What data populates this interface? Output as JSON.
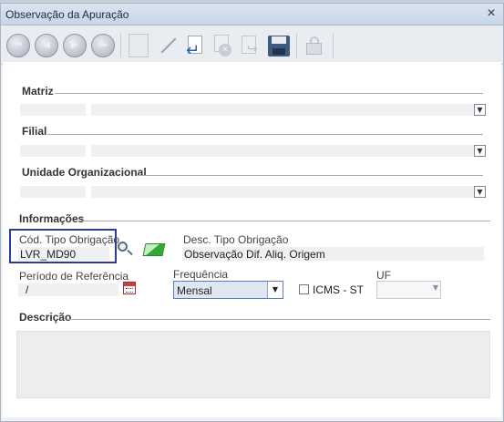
{
  "window": {
    "title": "Observação da Apuração"
  },
  "sections": {
    "matriz": "Matriz",
    "filial": "Filial",
    "unidade": "Unidade Organizacional",
    "informacoes": "Informações",
    "descricao": "Descrição"
  },
  "fields": {
    "cod_tipo_label": "Cód. Tipo Obrigação",
    "cod_tipo_value": "LVR_MD90",
    "desc_tipo_label": "Desc. Tipo Obrigação",
    "desc_tipo_value": "Observação Dif. Aliq. Origem",
    "periodo_label": "Período de Referência",
    "periodo_value": "/",
    "frequencia_label": "Frequência",
    "frequencia_value": "Mensal",
    "icms_label": "ICMS - ST",
    "uf_label": "UF"
  },
  "icons": [
    "first-record-icon",
    "previous-record-icon",
    "next-record-icon",
    "last-record-icon",
    "new-document-icon",
    "edit-icon",
    "save-edit-icon",
    "delete-icon",
    "cancel-icon",
    "floppy-disk-icon",
    "lock-icon",
    "search-icon",
    "clear-eraser-icon",
    "calendar-icon",
    "chevron-down-icon"
  ]
}
